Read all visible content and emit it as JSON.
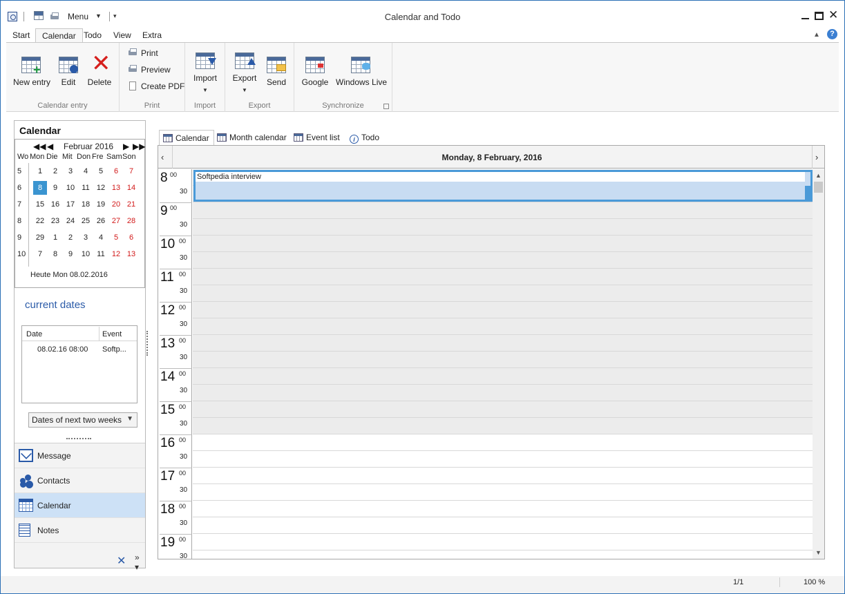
{
  "window": {
    "title": "Calendar and Todo",
    "quick_access_menu": "Menu"
  },
  "ribbon_tabs": [
    "Start",
    "Calendar",
    "Todo",
    "View",
    "Extra"
  ],
  "active_ribbon_tab": "Calendar",
  "ribbon": {
    "calendar_entry": {
      "label": "Calendar entry",
      "new_entry": "New entry",
      "edit": "Edit",
      "delete": "Delete"
    },
    "print": {
      "label": "Print",
      "print": "Print",
      "preview": "Preview",
      "create_pdf": "Create PDF"
    },
    "import": {
      "label": "Import",
      "button": "Import"
    },
    "export": {
      "label": "Export",
      "export": "Export",
      "send": "Send"
    },
    "synchronize": {
      "label": "Synchronize",
      "google": "Google",
      "windows_live": "Windows Live"
    }
  },
  "left_panel": {
    "title": "Calendar",
    "mini_calendar": {
      "month_label": "Februar 2016",
      "weekday_headers": [
        "Wo",
        "Mon",
        "Die",
        "Mit",
        "Don",
        "Fre",
        "Sam",
        "Son"
      ],
      "weeks": [
        {
          "wk": "5",
          "days": [
            "1",
            "2",
            "3",
            "4",
            "5",
            "6",
            "7"
          ]
        },
        {
          "wk": "6",
          "days": [
            "8",
            "9",
            "10",
            "11",
            "12",
            "13",
            "14"
          ]
        },
        {
          "wk": "7",
          "days": [
            "15",
            "16",
            "17",
            "18",
            "19",
            "20",
            "21"
          ]
        },
        {
          "wk": "8",
          "days": [
            "22",
            "23",
            "24",
            "25",
            "26",
            "27",
            "28"
          ]
        },
        {
          "wk": "9",
          "days": [
            "29",
            "1",
            "2",
            "3",
            "4",
            "5",
            "6"
          ]
        },
        {
          "wk": "10",
          "days": [
            "7",
            "8",
            "9",
            "10",
            "11",
            "12",
            "13"
          ]
        }
      ],
      "selected_day": "8",
      "today_label": "Heute Mon 08.02.2016"
    },
    "current_dates": {
      "title": "current dates",
      "columns": [
        "Date",
        "Event"
      ],
      "rows": [
        {
          "date": "08.02.16 08:00",
          "event": "Softp..."
        }
      ],
      "range_select": "Dates of next two weeks"
    },
    "nav": [
      "Message",
      "Contacts",
      "Calendar",
      "Notes"
    ],
    "active_nav": "Calendar"
  },
  "view_tabs": [
    "Calendar",
    "Month calendar",
    "Event list",
    "Todo"
  ],
  "active_view_tab": "Calendar",
  "day_view": {
    "date_header": "Monday, 8 February, 2016",
    "hours": [
      "8",
      "9",
      "10",
      "11",
      "12",
      "13",
      "14",
      "15",
      "16",
      "17",
      "18",
      "19"
    ],
    "minute_labels": {
      "full": "00",
      "half": "30"
    },
    "working_hours_end": "16",
    "events": [
      {
        "title": "Softpedia interview",
        "start": "08:00",
        "end": "09:00"
      }
    ]
  },
  "status": {
    "page": "1/1",
    "zoom": "100 %"
  },
  "colors": {
    "accent": "#3a94d0",
    "weekend": "#d21a1a",
    "event_border": "#4a9ad8",
    "event_fill": "#c8dcf2",
    "nav_active": "#cde1f6"
  }
}
